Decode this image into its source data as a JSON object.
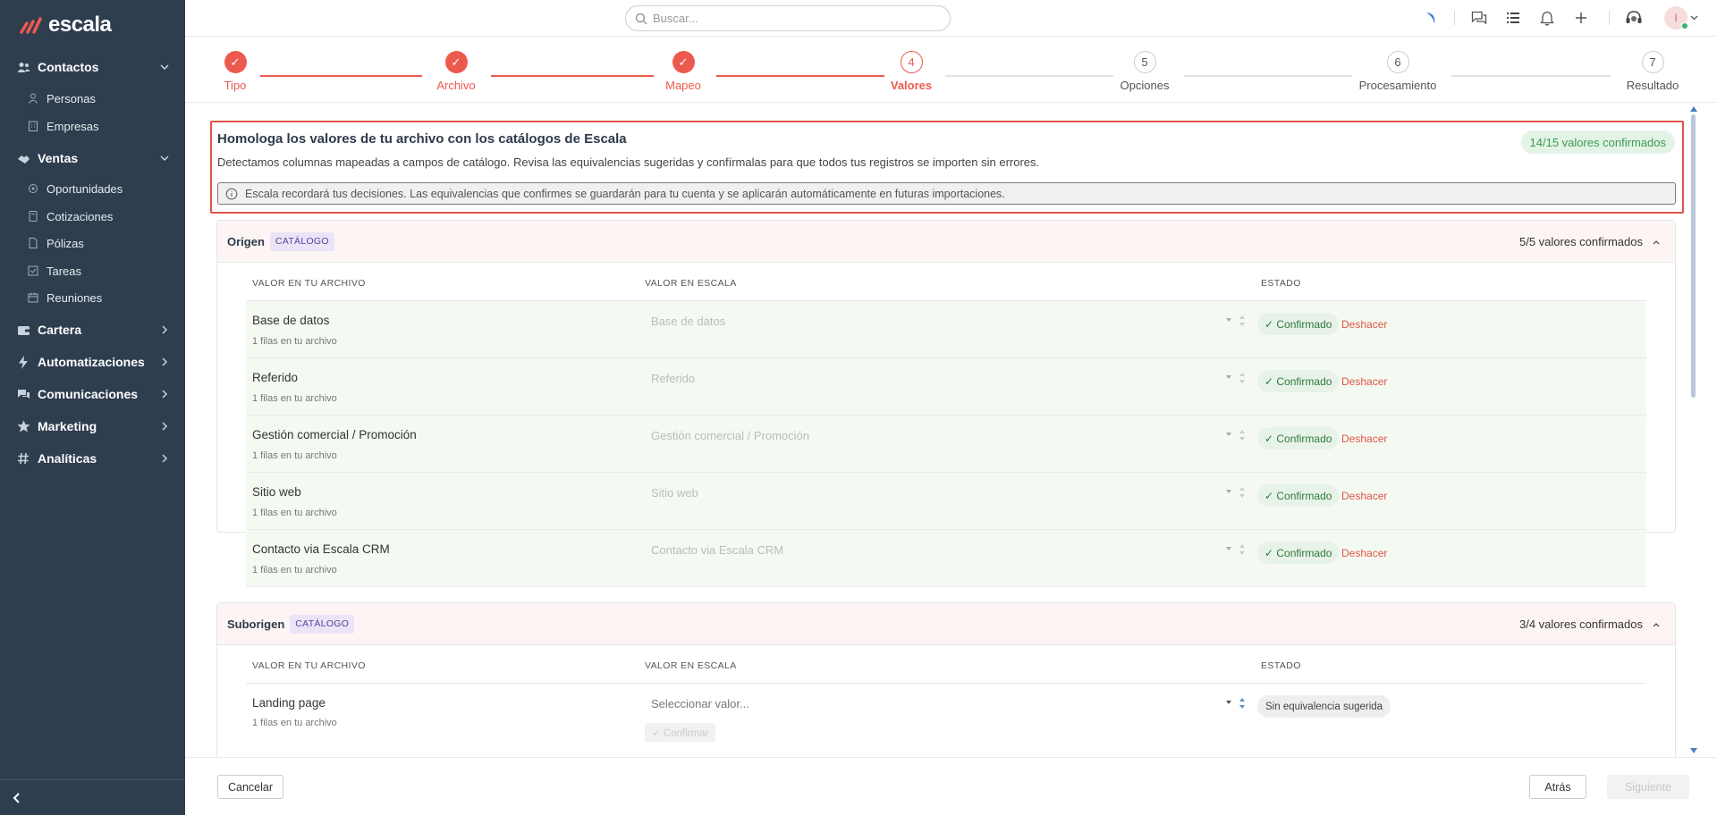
{
  "app": {
    "brand": "escala"
  },
  "sidebar": {
    "groups": [
      {
        "label": "Contactos",
        "icon": "users-icon",
        "expanded": true
      },
      {
        "label": "Ventas",
        "icon": "handshake-icon",
        "expanded": true
      },
      {
        "label": "Cartera",
        "icon": "wallet-icon",
        "expanded": false
      },
      {
        "label": "Automatizaciones",
        "icon": "bolt-icon",
        "expanded": false
      },
      {
        "label": "Comunicaciones",
        "icon": "chat-icon",
        "expanded": false
      },
      {
        "label": "Marketing",
        "icon": "star-icon",
        "expanded": false
      },
      {
        "label": "Analíticas",
        "icon": "hash-icon",
        "expanded": false
      }
    ],
    "contactos_items": [
      {
        "label": "Personas",
        "icon": "person-icon"
      },
      {
        "label": "Empresas",
        "icon": "building-icon"
      }
    ],
    "ventas_items": [
      {
        "label": "Oportunidades",
        "icon": "coins-icon"
      },
      {
        "label": "Cotizaciones",
        "icon": "calculator-icon"
      },
      {
        "label": "Pólizas",
        "icon": "document-icon"
      },
      {
        "label": "Tareas",
        "icon": "checkbox-icon"
      },
      {
        "label": "Reuniones",
        "icon": "calendar-icon"
      }
    ]
  },
  "topbar": {
    "search_placeholder": "Buscar...",
    "icons": [
      "brand-swoosh-icon",
      "chat-bubbles-icon",
      "list-icon",
      "bell-icon",
      "plus-icon",
      "headset-icon"
    ],
    "avatar_initial": "I"
  },
  "stepper": {
    "steps": [
      {
        "label": "Tipo",
        "number": "1",
        "status": "done"
      },
      {
        "label": "Archivo",
        "number": "2",
        "status": "done"
      },
      {
        "label": "Mapeo",
        "number": "3",
        "status": "done"
      },
      {
        "label": "Valores",
        "number": "4",
        "status": "current"
      },
      {
        "label": "Opciones",
        "number": "5",
        "status": "todo"
      },
      {
        "label": "Procesamiento",
        "number": "6",
        "status": "todo"
      },
      {
        "label": "Resultado",
        "number": "7",
        "status": "todo"
      }
    ]
  },
  "alert": {
    "title": "Homologa los valores de tu archivo con los catálogos de Escala",
    "description": "Detectamos columnas mapeadas a campos de catálogo. Revisa las equivalencias sugeridas y confírmalas para que todos tus registros se importen sin errores.",
    "badge": "14/15 valores confirmados",
    "info": "Escala recordará tus decisiones. Las equivalencias que confirmes se guardarán para tu cuenta y se aplicarán automáticamente en futuras importaciones."
  },
  "table_headers": {
    "archivo": "VALOR EN TU ARCHIVO",
    "escala": "VALOR EN ESCALA",
    "estado": "ESTADO"
  },
  "sections": [
    {
      "name": "Origen",
      "tag": "CATÁLOGO",
      "count": "5/5 valores confirmados",
      "rows": [
        {
          "value": "Base de datos",
          "rows_text": "1 filas en tu archivo",
          "mapped": "Base de datos",
          "status": "✓ Confirmado",
          "undo": "Deshacer"
        },
        {
          "value": "Referido",
          "rows_text": "1 filas en tu archivo",
          "mapped": "Referido",
          "status": "✓ Confirmado",
          "undo": "Deshacer"
        },
        {
          "value": "Gestión comercial / Promoción",
          "rows_text": "1 filas en tu archivo",
          "mapped": "Gestión comercial / Promoción",
          "status": "✓ Confirmado",
          "undo": "Deshacer"
        },
        {
          "value": "Sitio web",
          "rows_text": "1 filas en tu archivo",
          "mapped": "Sitio web",
          "status": "✓ Confirmado",
          "undo": "Deshacer"
        },
        {
          "value": "Contacto via Escala CRM",
          "rows_text": "1 filas en tu archivo",
          "mapped": "Contacto via Escala CRM",
          "status": "✓ Confirmado",
          "undo": "Deshacer"
        }
      ]
    },
    {
      "name": "Suborigen",
      "tag": "CATÁLOGO",
      "count": "3/4 valores confirmados",
      "rows": [
        {
          "value": "Landing page",
          "rows_text": "1 filas en tu archivo",
          "placeholder": "Seleccionar valor...",
          "status": "Sin equivalencia sugerida",
          "confirm": "✓ Confirmar"
        }
      ]
    }
  ],
  "footer": {
    "cancel": "Cancelar",
    "back": "Atrás",
    "next": "Siguiente"
  },
  "colors": {
    "sidebar": "#2e3e4f",
    "accent": "#ec5a4f",
    "success": "#3c9a54",
    "catalog_tag": "#5f3f9c"
  }
}
